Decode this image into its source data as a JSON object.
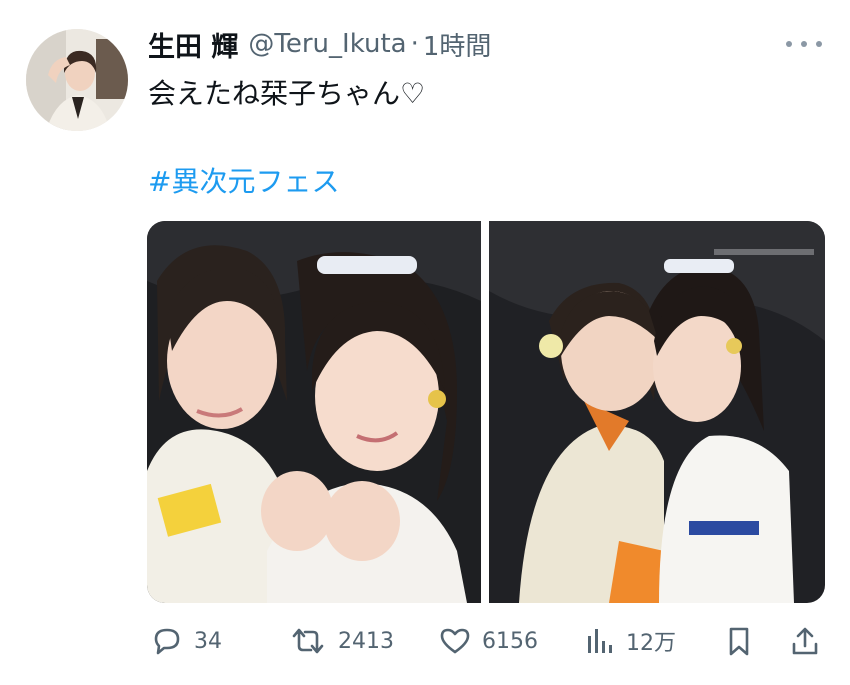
{
  "tweet": {
    "author_name": "生田 輝",
    "handle": "@Teru_Ikuta",
    "separator": "·",
    "time": "1時間",
    "text": "会えたね栞子ちゃん♡",
    "hashtag": "#異次元フェス"
  },
  "actions": {
    "replies": "34",
    "retweets": "2413",
    "likes": "6156",
    "views": "12万"
  },
  "icons": {
    "reply": "speech-bubble-icon",
    "retweet": "retweet-arrows-icon",
    "like": "heart-icon",
    "views": "bar-chart-icon",
    "bookmark": "bookmark-icon",
    "share": "share-upload-icon",
    "more": "three-dots-icon"
  },
  "colors": {
    "link": "#1d9bf0",
    "secondary_text": "#536471",
    "primary_text": "#0f1419"
  }
}
